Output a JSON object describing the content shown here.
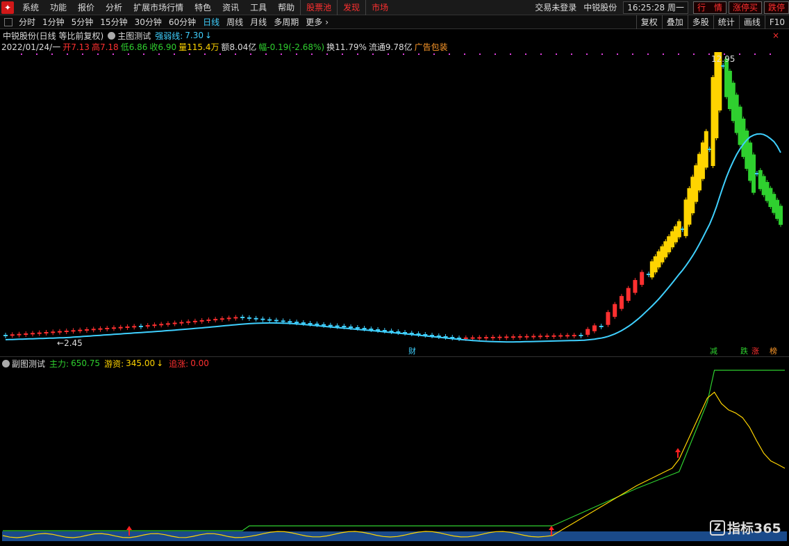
{
  "menu": {
    "logo": "",
    "items": [
      "系统",
      "功能",
      "报价",
      "分析",
      "扩展市场行情",
      "特色",
      "资讯",
      "工具",
      "帮助"
    ],
    "red_items": [
      "股票池",
      "发现",
      "市场"
    ],
    "status": "交易未登录",
    "stock": "中锐股份",
    "clock": "16:25:28 周一",
    "quick": [
      "行　情",
      "涨停买",
      "跌停"
    ]
  },
  "tabs": {
    "items": [
      "分时",
      "1分钟",
      "5分钟",
      "15分钟",
      "30分钟",
      "60分钟",
      "日线",
      "周线",
      "月线",
      "多周期",
      "更多"
    ],
    "active": "日线",
    "right": [
      "复权",
      "叠加",
      "多股",
      "统计",
      "画线",
      "F10"
    ]
  },
  "header": {
    "title": "中锐股份(日线 等比前复权)",
    "indicator": "主图测试",
    "strength_label": "强弱线:",
    "strength_value": "7.30",
    "strength_arrow": "↓",
    "close_icon": "×"
  },
  "quote": {
    "date": "2022/01/24/一",
    "open": "开7.13",
    "high": "高7.18",
    "low": "低6.86",
    "close": "收6.90",
    "volume": "量115.4万",
    "amount": "额8.04亿",
    "change": "幅-0.19(-2.68%)",
    "turnover": "换11.79%",
    "float": "流通9.78亿",
    "ad": "广告包装"
  },
  "chart": {
    "max_label": "12.95",
    "min_label": "2.45",
    "marker_cai": "财",
    "tags": [
      "减",
      "跌",
      "涨",
      "榜"
    ]
  },
  "sub": {
    "name": "副图测试",
    "main_label": "主力:",
    "main_value": "650.75",
    "hot_label": "游资:",
    "hot_value": "345.00",
    "hot_arrow": "↓",
    "chase_label": "追涨:",
    "chase_value": "0.00"
  },
  "watermark": {
    "mark": "Z",
    "text": "指标365"
  },
  "chart_data": {
    "type": "candlestick",
    "price_max": 12.95,
    "price_min": 2.45,
    "colors": {
      "up": "#ff3030",
      "down": "#3fd0ff",
      "ma": "#3fd0ff",
      "signal_up": "#ffd400",
      "signal_down": "#2fd02f",
      "sub_main": "#2fd02f",
      "sub_hot": "#ffd400"
    }
  }
}
